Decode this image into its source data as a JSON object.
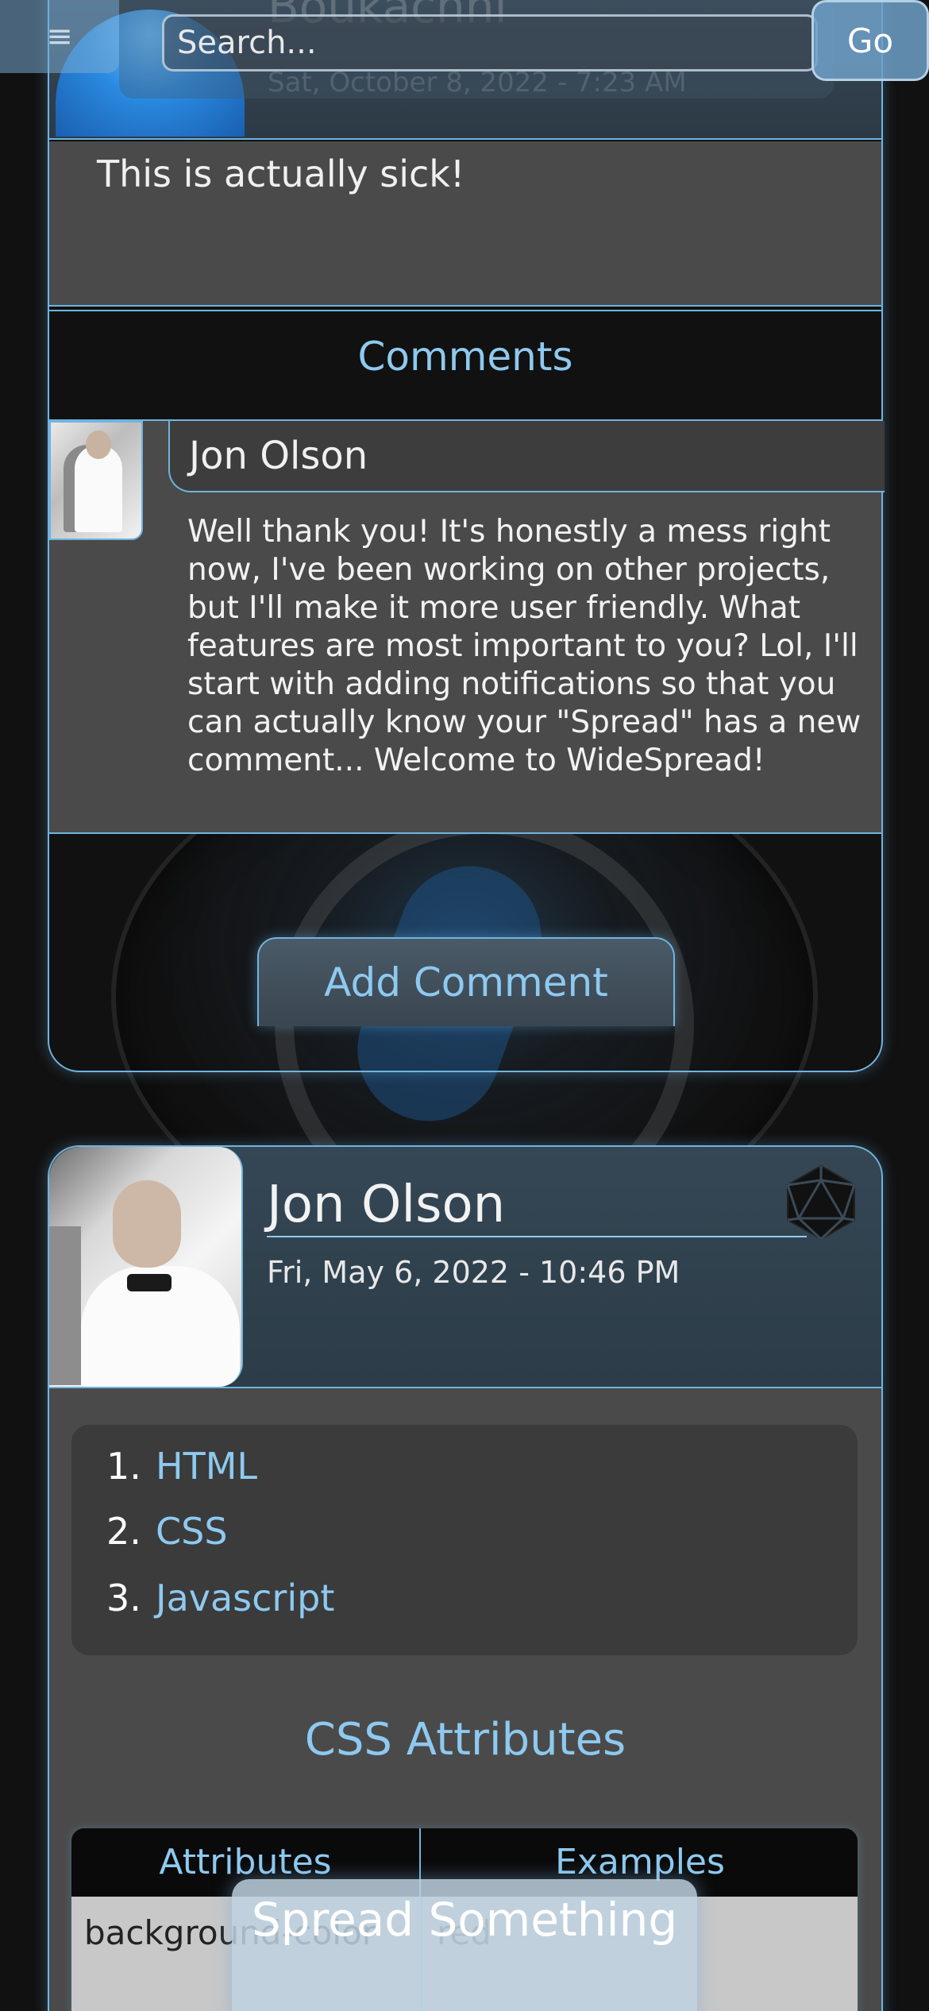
{
  "nav": {
    "menu_icon": "hamburger-icon",
    "menu_glyph": "≡",
    "search_placeholder": "Search...",
    "go_label": "Go"
  },
  "post1": {
    "author": "Boukachni",
    "date": "Sat, October 8, 2022 - 7:23 AM",
    "body": "This is actually sick!",
    "comments_title": "Comments",
    "comments": [
      {
        "author": "Jon Olson",
        "text": " Well thank you! It's honestly a mess right now, I've been working on other projects, but I'll make it more user friendly. What features are most important to you? Lol, I'll start with adding notifications so that you can actually know your \"Spread\" has a new comment... Welcome to WideSpread!"
      }
    ],
    "add_comment_label": "Add Comment"
  },
  "post2": {
    "author": "Jon Olson",
    "date": "Fri, May 6, 2022 - 10:46 PM",
    "badge_icon": "d20-icon",
    "list": [
      {
        "num": "1.",
        "label": "HTML"
      },
      {
        "num": "2.",
        "label": "CSS"
      },
      {
        "num": "3.",
        "label": "Javascript"
      }
    ],
    "section_title": "CSS Attributes",
    "table": {
      "headers": [
        "Attributes",
        "Examples"
      ],
      "rows": [
        [
          "background-color",
          "red"
        ]
      ]
    }
  },
  "spread_button_label": "Spread Something",
  "colors": {
    "accent": "#8ec9f0",
    "border": "#6fb4e0",
    "card_bg": "#4a4a4a",
    "page_bg": "#111111"
  }
}
